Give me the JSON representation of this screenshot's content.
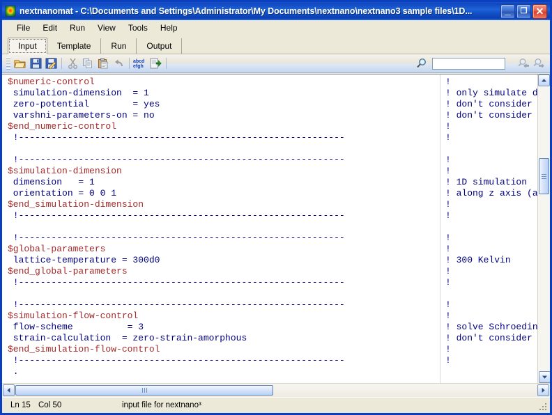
{
  "window": {
    "title": "nextnanomat - C:\\Documents and Settings\\Administrator\\My Documents\\nextnano\\nextnano3 sample files\\1D...",
    "app_icon": "nextnano-logo-icon",
    "minimize_label": "_",
    "maximize_label": "❐",
    "close_label": "✕"
  },
  "menubar": {
    "items": [
      {
        "label": "File"
      },
      {
        "label": "Edit"
      },
      {
        "label": "Run"
      },
      {
        "label": "View"
      },
      {
        "label": "Tools"
      },
      {
        "label": "Help"
      }
    ]
  },
  "tabs": {
    "active": "Input",
    "items": [
      {
        "label": "Input"
      },
      {
        "label": "Template"
      },
      {
        "label": "Run"
      },
      {
        "label": "Output"
      }
    ]
  },
  "toolbar": {
    "buttons": [
      {
        "name": "open-file-icon",
        "title": "Open"
      },
      {
        "name": "save-file-icon",
        "title": "Save"
      },
      {
        "name": "save-as-icon",
        "title": "Save As"
      },
      {
        "name": "cut-icon",
        "title": "Cut"
      },
      {
        "name": "copy-icon",
        "title": "Copy"
      },
      {
        "name": "paste-icon",
        "title": "Paste"
      },
      {
        "name": "undo-icon",
        "title": "Undo"
      },
      {
        "name": "font-abcd-icon",
        "title": "Font"
      },
      {
        "name": "run-simulation-icon",
        "title": "Run"
      }
    ],
    "search": {
      "icon": "search-magnifier-icon",
      "value": "",
      "placeholder": ""
    },
    "find_prev_icon": "find-previous-icon",
    "find_next_icon": "find-next-icon"
  },
  "editor": {
    "lines": [
      {
        "indent": 0,
        "segments": [
          {
            "t": "$numeric-control",
            "c": "kw"
          }
        ]
      },
      {
        "indent": 1,
        "segments": [
          {
            "t": " simulation-dimension  = 1",
            "c": "cm"
          }
        ]
      },
      {
        "indent": 1,
        "segments": [
          {
            "t": " zero-potential        = yes",
            "c": "cm"
          }
        ]
      },
      {
        "indent": 1,
        "segments": [
          {
            "t": " varshni-parameters-on = no",
            "c": "cm"
          }
        ]
      },
      {
        "indent": 0,
        "segments": [
          {
            "t": "$end_numeric-control",
            "c": "kw"
          }
        ]
      },
      {
        "indent": 0,
        "segments": [
          {
            "t": " !------------------------------------------------------------",
            "c": "cm"
          }
        ]
      },
      {
        "indent": 0,
        "segments": [
          {
            "t": "",
            "c": "cm"
          }
        ]
      },
      {
        "indent": 0,
        "segments": [
          {
            "t": " !------------------------------------------------------------",
            "c": "cm"
          }
        ]
      },
      {
        "indent": 0,
        "segments": [
          {
            "t": "$simulation-dimension",
            "c": "kw"
          }
        ]
      },
      {
        "indent": 1,
        "segments": [
          {
            "t": " dimension   = 1",
            "c": "cm"
          }
        ]
      },
      {
        "indent": 1,
        "segments": [
          {
            "t": " orientation = 0 0 1",
            "c": "cm"
          }
        ]
      },
      {
        "indent": 0,
        "segments": [
          {
            "t": "$end_simulation-dimension",
            "c": "kw"
          }
        ]
      },
      {
        "indent": 0,
        "segments": [
          {
            "t": " !------------------------------------------------------------",
            "c": "cm"
          }
        ]
      },
      {
        "indent": 0,
        "segments": [
          {
            "t": "",
            "c": "cm"
          }
        ]
      },
      {
        "indent": 0,
        "segments": [
          {
            "t": " !------------------------------------------------------------",
            "c": "cm"
          }
        ]
      },
      {
        "indent": 0,
        "segments": [
          {
            "t": "$global-parameters",
            "c": "kw"
          }
        ]
      },
      {
        "indent": 1,
        "segments": [
          {
            "t": " lattice-temperature = 300d0",
            "c": "cm"
          }
        ]
      },
      {
        "indent": 0,
        "segments": [
          {
            "t": "$end_global-parameters",
            "c": "kw"
          }
        ]
      },
      {
        "indent": 0,
        "segments": [
          {
            "t": " !------------------------------------------------------------",
            "c": "cm"
          }
        ]
      },
      {
        "indent": 0,
        "segments": [
          {
            "t": "",
            "c": "cm"
          }
        ]
      },
      {
        "indent": 0,
        "segments": [
          {
            "t": " !------------------------------------------------------------",
            "c": "cm"
          }
        ]
      },
      {
        "indent": 0,
        "segments": [
          {
            "t": "$simulation-flow-control",
            "c": "kw"
          }
        ]
      },
      {
        "indent": 1,
        "segments": [
          {
            "t": " flow-scheme          = 3",
            "c": "cm"
          }
        ]
      },
      {
        "indent": 1,
        "segments": [
          {
            "t": " strain-calculation  = zero-strain-amorphous",
            "c": "cm"
          }
        ]
      },
      {
        "indent": 0,
        "segments": [
          {
            "t": "$end_simulation-flow-control",
            "c": "kw"
          }
        ]
      },
      {
        "indent": 0,
        "segments": [
          {
            "t": " !------------------------------------------------------------",
            "c": "cm"
          }
        ]
      },
      {
        "indent": 0,
        "segments": [
          {
            "t": " .",
            "c": "cm"
          }
        ]
      }
    ],
    "comment_lines": [
      {
        "row": 0,
        "text": "!"
      },
      {
        "row": 1,
        "text": "! only simulate di"
      },
      {
        "row": 2,
        "text": "! don't consider c"
      },
      {
        "row": 3,
        "text": "! don't consider t"
      },
      {
        "row": 4,
        "text": "!"
      },
      {
        "row": 5,
        "text": "!"
      },
      {
        "row": 7,
        "text": "!"
      },
      {
        "row": 8,
        "text": "!"
      },
      {
        "row": 9,
        "text": "! 1D simulation"
      },
      {
        "row": 10,
        "text": "! along z axis (as"
      },
      {
        "row": 11,
        "text": "!"
      },
      {
        "row": 12,
        "text": "!"
      },
      {
        "row": 14,
        "text": "!"
      },
      {
        "row": 15,
        "text": "!"
      },
      {
        "row": 16,
        "text": "! 300 Kelvin"
      },
      {
        "row": 17,
        "text": "!"
      },
      {
        "row": 18,
        "text": "!"
      },
      {
        "row": 20,
        "text": "!"
      },
      {
        "row": 21,
        "text": "!"
      },
      {
        "row": 22,
        "text": "! solve Schroeding"
      },
      {
        "row": 23,
        "text": "! don't consider s"
      },
      {
        "row": 24,
        "text": "!"
      },
      {
        "row": 25,
        "text": "!"
      }
    ],
    "scroll_up_icon": "scroll-up-arrow-icon",
    "scroll_down_icon": "scroll-down-arrow-icon",
    "scroll_left_icon": "scroll-left-arrow-icon",
    "scroll_right_icon": "scroll-right-arrow-icon"
  },
  "statusbar": {
    "line": "Ln 15",
    "column": "Col 50",
    "message": "input file for nextnano³"
  },
  "colors": {
    "keyword": "#a52a2a",
    "text": "#000080",
    "titlebar": "#0f46bf",
    "chrome": "#ece9d8"
  }
}
